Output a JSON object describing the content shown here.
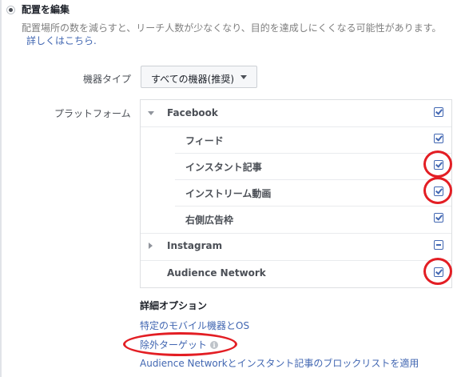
{
  "header": {
    "title": "配置を編集",
    "description": "配置場所の数を減らすと、リーチ人数が少なくなり、目的を達成しにくくなる可能性があります。",
    "learn_more": "詳しくはこちら."
  },
  "device_type": {
    "label": "機器タイプ",
    "selected": "すべての機器(推奨)"
  },
  "platforms": {
    "label": "プラットフォーム",
    "facebook": {
      "label": "Facebook",
      "items": [
        {
          "label": "フィード",
          "checked": true
        },
        {
          "label": "インスタント記事",
          "checked": true
        },
        {
          "label": "インストリーム動画",
          "checked": true
        },
        {
          "label": "右側広告枠",
          "checked": true
        }
      ]
    },
    "instagram": {
      "label": "Instagram",
      "state": "partial"
    },
    "audience_network": {
      "label": "Audience Network",
      "checked": true
    }
  },
  "advanced": {
    "title": "詳細オプション",
    "links": [
      "特定のモバイル機器とOS",
      "除外ターゲット",
      "Audience Networkとインスタント記事のブロックリストを適用"
    ],
    "info_icon": "i"
  },
  "colors": {
    "link": "#4267b2",
    "annotation": "#e31e24"
  }
}
